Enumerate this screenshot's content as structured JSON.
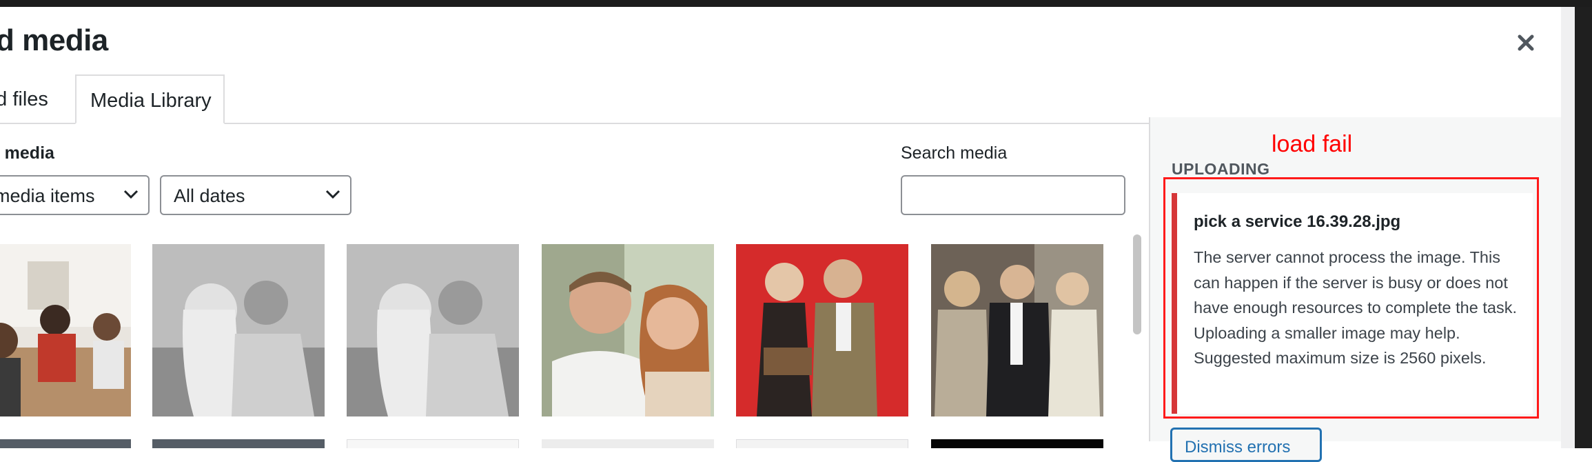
{
  "modal": {
    "title": "d media",
    "close_icon": "close-icon"
  },
  "tabs": {
    "upload_label": "ad files",
    "library_label": "Media Library"
  },
  "filters": {
    "label": "r media",
    "type_value": "media items",
    "date_value": "All dates"
  },
  "search": {
    "label": "Search media",
    "value": ""
  },
  "media_grid": {
    "items": [
      {
        "description": "office meeting photo",
        "icon": "image-thumbnail"
      },
      {
        "description": "black and white couple portrait",
        "icon": "image-thumbnail"
      },
      {
        "description": "black and white couple portrait",
        "icon": "image-thumbnail"
      },
      {
        "description": "smiling couple color photo",
        "icon": "image-thumbnail"
      },
      {
        "description": "couple at red event backdrop",
        "icon": "image-thumbnail"
      },
      {
        "description": "group photo at event",
        "icon": "image-thumbnail"
      }
    ]
  },
  "sidebar": {
    "heading": "UPLOADING",
    "annotation": "load fail",
    "annotation_color": "#ff0000",
    "error": {
      "filename": "pick a service 16.39.28.jpg",
      "message": "The server cannot process the image. This can happen if the server is busy or does not have enough resources to complete the task. Uploading a smaller image may help. Suggested maximum size is 2560 pixels.",
      "color": "#d63638"
    },
    "dismiss_label": "Dismiss errors"
  },
  "colors": {
    "accent": "#2271b1",
    "error": "#d63638",
    "annotation": "#ff0000"
  }
}
